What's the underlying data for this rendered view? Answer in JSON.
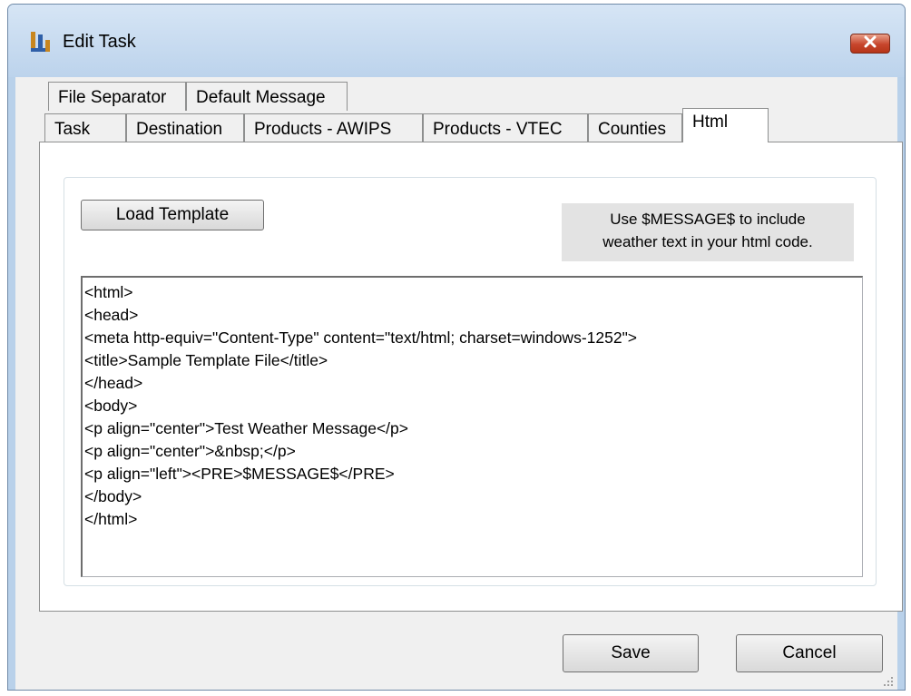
{
  "window": {
    "title": "Edit Task"
  },
  "tabs": {
    "row1": [
      "File Separator",
      "Default Message"
    ],
    "row2": [
      "Task",
      "Destination",
      "Products - AWIPS",
      "Products - VTEC",
      "Counties",
      "Html"
    ],
    "active": "Html"
  },
  "html_tab": {
    "load_template_label": "Load Template",
    "note_line1": "Use $MESSAGE$ to include",
    "note_line2": "weather text in your html code.",
    "template_code": "<html>\n<head>\n<meta http-equiv=\"Content-Type\" content=\"text/html; charset=windows-1252\">\n<title>Sample Template File</title>\n</head>\n<body>\n<p align=\"center\">Test Weather Message</p>\n<p align=\"center\">&nbsp;</p>\n<p align=\"left\"><PRE>$MESSAGE$</PRE>\n</body>\n</html>"
  },
  "footer": {
    "save_label": "Save",
    "cancel_label": "Cancel"
  },
  "icons": {
    "app": "app-logo-icon",
    "close": "close-icon",
    "grip": "resize-grip-icon"
  },
  "colors": {
    "title_bar": "#bcd3ec",
    "close_button": "#c7452c",
    "face": "#f0f0f0"
  }
}
